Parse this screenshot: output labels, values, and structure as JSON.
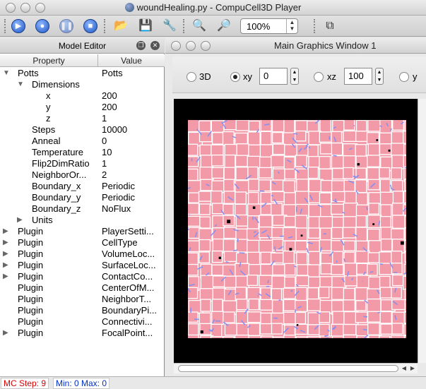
{
  "window": {
    "title": "woundHealing.py - CompuCell3D Player"
  },
  "toolbar": {
    "zoom_value": "100%"
  },
  "model_editor": {
    "title": "Model Editor",
    "columns": [
      "Property",
      "Value"
    ],
    "rows": [
      {
        "prop": "Potts",
        "value": "Potts",
        "level": 0,
        "arrow": "▼"
      },
      {
        "prop": "Dimensions",
        "value": "",
        "level": 1,
        "arrow": "▼"
      },
      {
        "prop": "x",
        "value": "200",
        "level": 2,
        "arrow": ""
      },
      {
        "prop": "y",
        "value": "200",
        "level": 2,
        "arrow": ""
      },
      {
        "prop": "z",
        "value": "1",
        "level": 2,
        "arrow": ""
      },
      {
        "prop": "Steps",
        "value": "10000",
        "level": 1,
        "arrow": ""
      },
      {
        "prop": "Anneal",
        "value": "0",
        "level": 1,
        "arrow": ""
      },
      {
        "prop": "Temperature",
        "value": "10",
        "level": 1,
        "arrow": ""
      },
      {
        "prop": "Flip2DimRatio",
        "value": "1",
        "level": 1,
        "arrow": ""
      },
      {
        "prop": "NeighborOr...",
        "value": "2",
        "level": 1,
        "arrow": ""
      },
      {
        "prop": "Boundary_x",
        "value": "Periodic",
        "level": 1,
        "arrow": ""
      },
      {
        "prop": "Boundary_y",
        "value": "Periodic",
        "level": 1,
        "arrow": ""
      },
      {
        "prop": "Boundary_z",
        "value": "NoFlux",
        "level": 1,
        "arrow": ""
      },
      {
        "prop": "Units",
        "value": "",
        "level": 1,
        "arrow": "▶"
      },
      {
        "prop": "Plugin",
        "value": "PlayerSetti...",
        "level": 0,
        "arrow": "▶"
      },
      {
        "prop": "Plugin",
        "value": "CellType",
        "level": 0,
        "arrow": "▶"
      },
      {
        "prop": "Plugin",
        "value": "VolumeLoc...",
        "level": 0,
        "arrow": "▶"
      },
      {
        "prop": "Plugin",
        "value": "SurfaceLoc...",
        "level": 0,
        "arrow": "▶"
      },
      {
        "prop": "Plugin",
        "value": "ContactCo...",
        "level": 0,
        "arrow": "▶"
      },
      {
        "prop": "Plugin",
        "value": "CenterOfM...",
        "level": 0,
        "arrow": ""
      },
      {
        "prop": "Plugin",
        "value": "NeighborT...",
        "level": 0,
        "arrow": ""
      },
      {
        "prop": "Plugin",
        "value": "BoundaryPi...",
        "level": 0,
        "arrow": ""
      },
      {
        "prop": "Plugin",
        "value": "Connectivi...",
        "level": 0,
        "arrow": ""
      },
      {
        "prop": "Plugin",
        "value": "FocalPoint...",
        "level": 0,
        "arrow": "▶"
      }
    ]
  },
  "graphics": {
    "title": "Main Graphics Window 1",
    "proj_3d": "3D",
    "proj_xy": "xy",
    "xy_value": "0",
    "proj_xz": "xz",
    "xz_value": "100",
    "proj_yz": "y"
  },
  "colors": {
    "cell_fill": "#f39aa8",
    "cell_border": "#ffffff",
    "field": "#7f8ff5",
    "background": "#000000"
  },
  "status": {
    "mc_step": "MC Step: 9",
    "min_max": "Min: 0 Max: 0"
  }
}
